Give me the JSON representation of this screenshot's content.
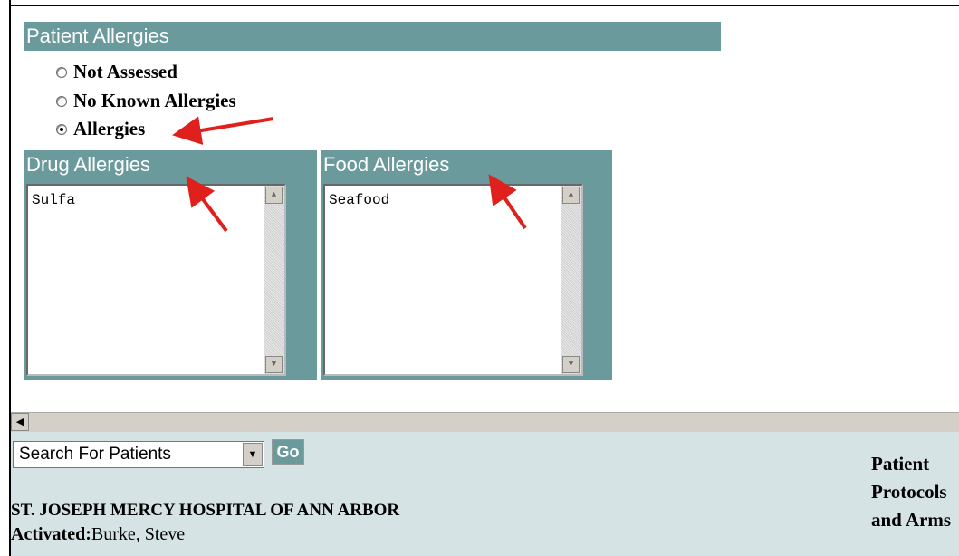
{
  "page_title": "",
  "patient_allergies": {
    "header": "Patient Allergies",
    "options": [
      {
        "label": "Not Assessed",
        "selected": false
      },
      {
        "label": "No Known Allergies",
        "selected": false
      },
      {
        "label": "Allergies",
        "selected": true
      }
    ]
  },
  "drug_allergies": {
    "header": "Drug Allergies",
    "value": "Sulfa"
  },
  "food_allergies": {
    "header": "Food Allergies",
    "value": "Seafood"
  },
  "footer": {
    "search_select": "Search For Patients",
    "go_label": "Go",
    "hospital": "ST. JOSEPH MERCY HOSPITAL OF ANN ARBOR",
    "activated_label": "Activated:",
    "activated_value": "Burke, Steve",
    "links": [
      "Patient",
      "Protocols",
      "and Arms"
    ]
  },
  "colors": {
    "header_bar": "#6a9a9c",
    "footer_bg": "#d6e3e4",
    "arrow": "#e0201c",
    "title_green": "#2e8b2e"
  }
}
